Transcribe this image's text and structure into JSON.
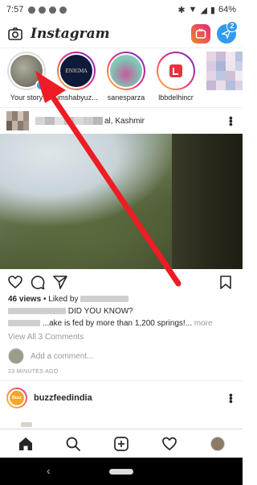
{
  "status_bar": {
    "time": "7:57",
    "battery": "64%"
  },
  "header": {
    "logo": "Instagram",
    "dm_badge": "2"
  },
  "stories": [
    {
      "label": "Your story",
      "self": true,
      "colors": [
        "#8a8a7a",
        "#5c5a4f"
      ]
    },
    {
      "label": "umshabyuz...",
      "colors": [
        "#0f1a3a",
        "#1d2b55"
      ],
      "text": "ENIGMA"
    },
    {
      "label": "sanesparza",
      "colors": [
        "#9ad6c8",
        "#c65a9c"
      ]
    },
    {
      "label": "lbbdelhincr",
      "colors": [
        "#ffffff",
        "#e0363f"
      ]
    },
    {
      "label": "",
      "colors": [
        "#d6c4d0",
        "#a9b5d8"
      ]
    }
  ],
  "post": {
    "location": "al, Kashmir",
    "views": "46 views",
    "liked_by_prefix": "• Liked by",
    "caption_line1": "DID YOU KNOW?",
    "caption_line2": "...ake is fed by more than 1,200 springs!...",
    "caption_more": "more",
    "view_all": "View All 3 Comments",
    "add_comment": "Add a comment...",
    "timestamp": "23 MINUTES AGO"
  },
  "next_post": {
    "username": "buzzfeedindia",
    "avatar_text": "Buzz Feed"
  }
}
